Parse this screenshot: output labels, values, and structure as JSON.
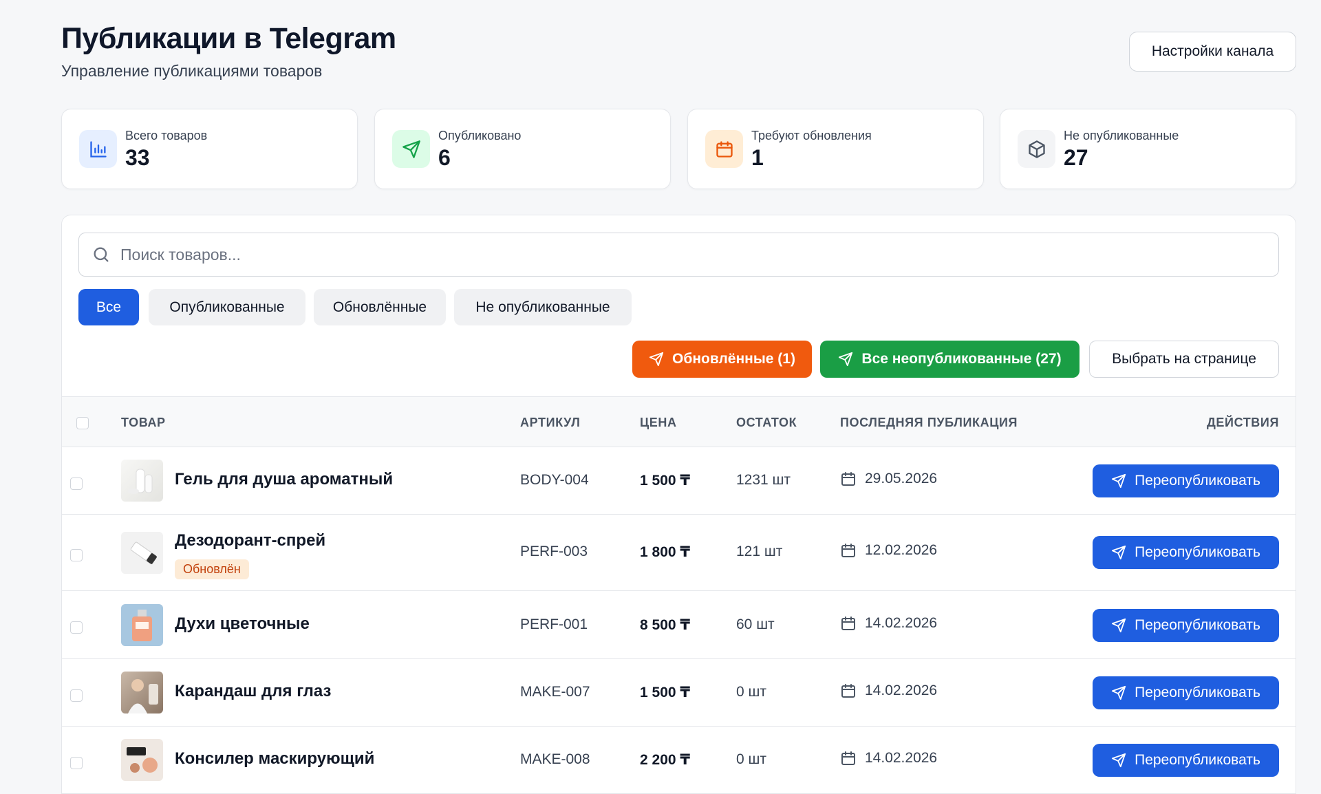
{
  "header": {
    "title": "Публикации в Telegram",
    "subtitle": "Управление публикациями товаров",
    "settings_label": "Настройки канала"
  },
  "stats": [
    {
      "label": "Всего товаров",
      "value": "33",
      "icon": "bar-chart-icon",
      "color": "#2563eb",
      "bg": "#e6efff"
    },
    {
      "label": "Опубликовано",
      "value": "6",
      "icon": "send-icon",
      "color": "#16a34a",
      "bg": "#dcfce7"
    },
    {
      "label": "Требуют обновления",
      "value": "1",
      "icon": "calendar-icon",
      "color": "#ea580c",
      "bg": "#ffedd5"
    },
    {
      "label": "Не опубликованные",
      "value": "27",
      "icon": "package-icon",
      "color": "#4b5563",
      "bg": "#f3f4f6"
    }
  ],
  "search": {
    "placeholder": "Поиск товаров..."
  },
  "filters": [
    {
      "label": "Все",
      "active": true
    },
    {
      "label": "Опубликованные",
      "active": false
    },
    {
      "label": "Обновлённые",
      "active": false
    },
    {
      "label": "Не опубликованные",
      "active": false
    }
  ],
  "actions": {
    "updated_label": "Обновлённые (1)",
    "all_unpublished_label": "Все неопубликованные (27)",
    "select_page_label": "Выбрать на странице"
  },
  "table": {
    "columns": {
      "product": "ТОВАР",
      "sku": "АРТИКУЛ",
      "price": "ЦЕНА",
      "stock": "ОСТАТОК",
      "last_pub": "ПОСЛЕДНЯЯ ПУБЛИКАЦИЯ",
      "actions": "ДЕЙСТВИЯ"
    },
    "rows": [
      {
        "name": "Гель для душа ароматный",
        "badge": "",
        "sku": "BODY-004",
        "price": "1 500 ₸",
        "stock": "1231 шт",
        "date": "29.05.2026",
        "action": "Переопубликовать"
      },
      {
        "name": "Дезодорант-спрей",
        "badge": "Обновлён",
        "sku": "PERF-003",
        "price": "1 800 ₸",
        "stock": "121 шт",
        "date": "12.02.2026",
        "action": "Переопубликовать"
      },
      {
        "name": "Духи цветочные",
        "badge": "",
        "sku": "PERF-001",
        "price": "8 500 ₸",
        "stock": "60 шт",
        "date": "14.02.2026",
        "action": "Переопубликовать"
      },
      {
        "name": "Карандаш для глаз",
        "badge": "",
        "sku": "MAKE-007",
        "price": "1 500 ₸",
        "stock": "0 шт",
        "date": "14.02.2026",
        "action": "Переопубликовать"
      },
      {
        "name": "Консилер маскирующий",
        "badge": "",
        "sku": "MAKE-008",
        "price": "2 200 ₸",
        "stock": "0 шт",
        "date": "14.02.2026",
        "action": "Переопубликовать"
      }
    ]
  },
  "colors": {
    "primary": "#1f5ee0",
    "orange": "#f05a0e",
    "green": "#1a9e45",
    "badge_bg": "#fdebd6",
    "badge_text": "#c2410c"
  }
}
